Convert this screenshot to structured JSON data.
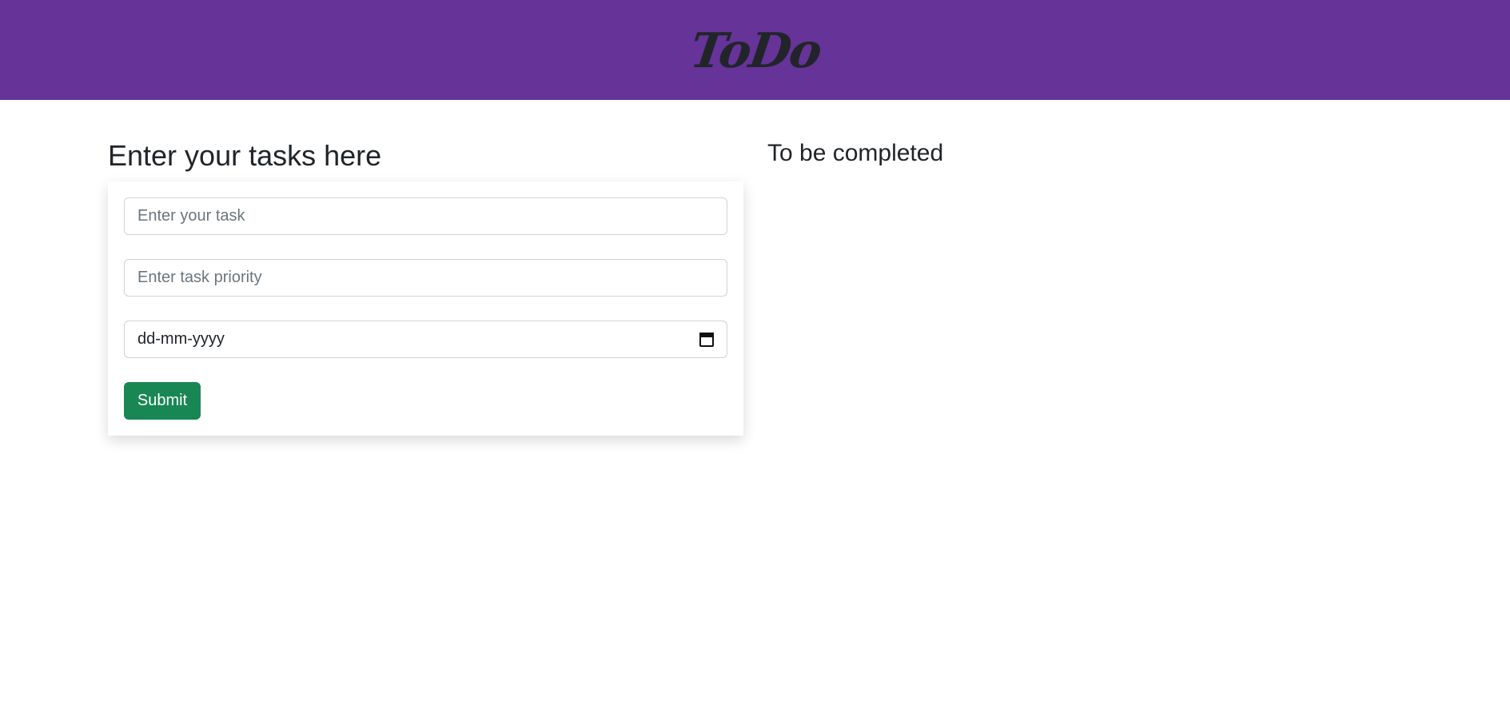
{
  "header": {
    "brand": "ToDo",
    "background_color": "#663399"
  },
  "form_section": {
    "heading": "Enter your tasks here",
    "task_input": {
      "placeholder": "Enter your task",
      "value": ""
    },
    "priority_input": {
      "placeholder": "Enter task priority",
      "value": ""
    },
    "date_input": {
      "value": "dd-mm-yyyy",
      "icon": "calendar-icon"
    },
    "submit_label": "Submit",
    "submit_color": "#198754"
  },
  "tasks_section": {
    "heading": "To be completed"
  }
}
